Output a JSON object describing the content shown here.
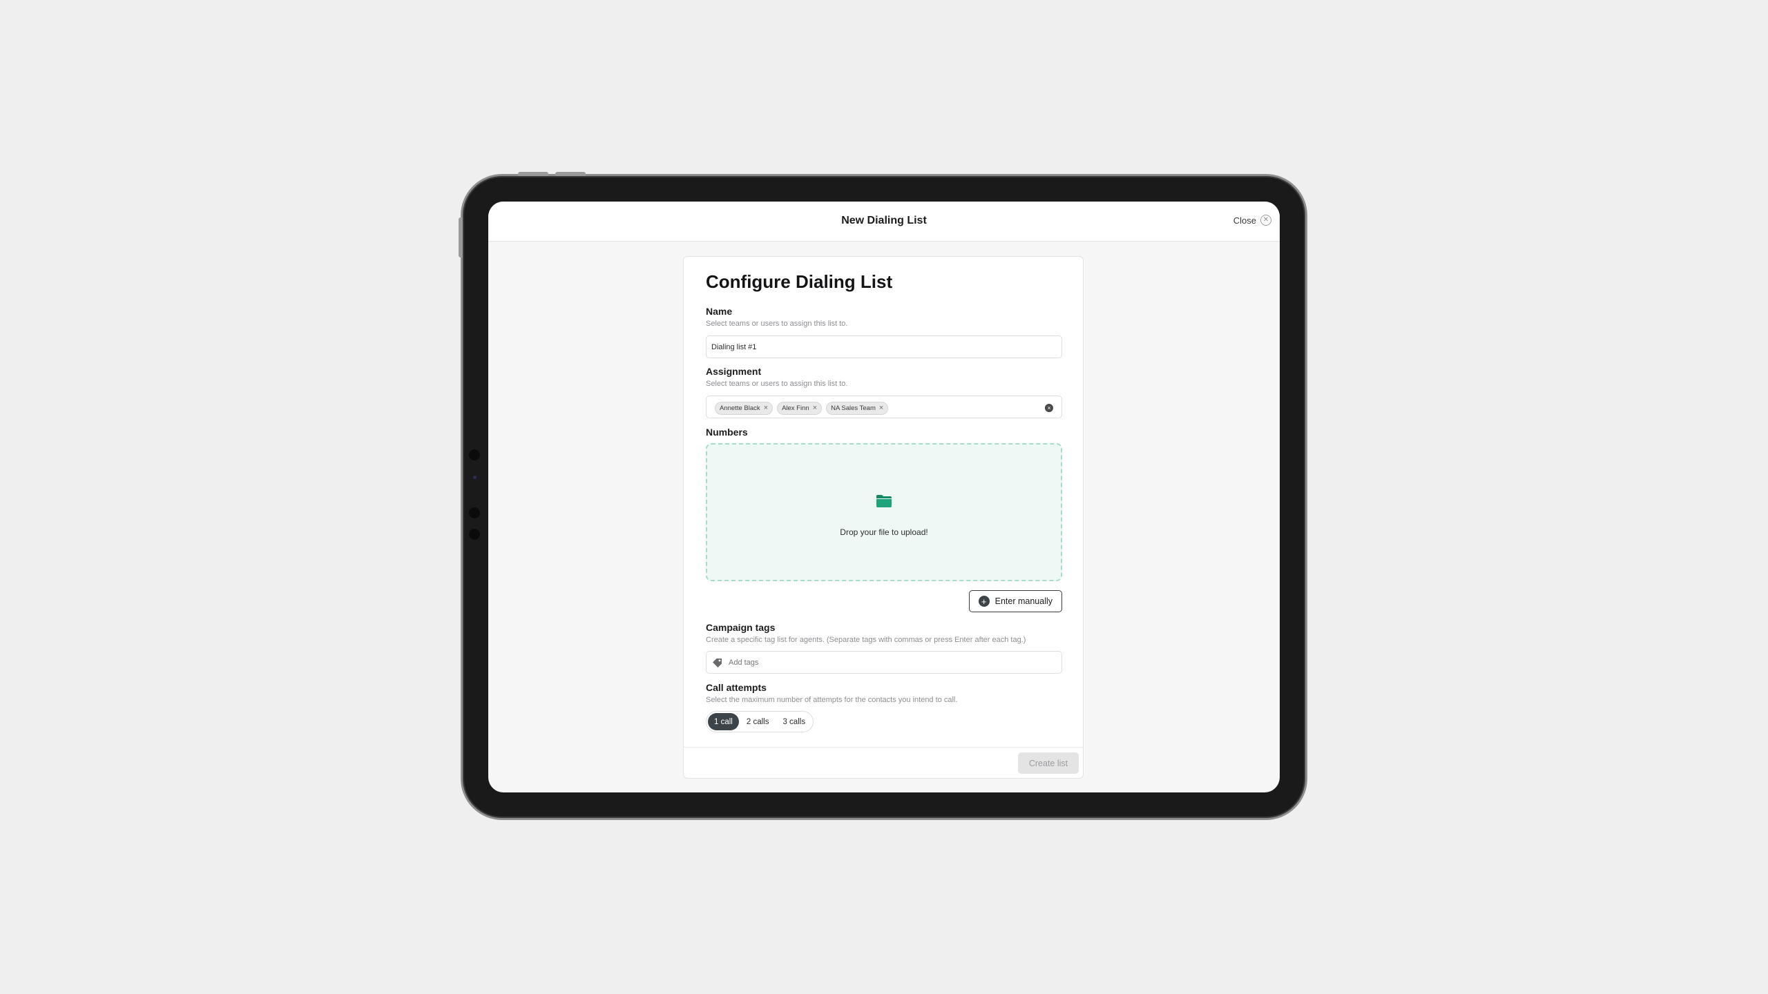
{
  "window": {
    "title": "New Dialing List",
    "close_label": "Close",
    "close_icon": "close-icon"
  },
  "form": {
    "heading": "Configure Dialing List",
    "name": {
      "label": "Name",
      "help": "Select teams or users to assign this list to.",
      "value": "Dialing list #1"
    },
    "assignment": {
      "label": "Assignment",
      "help": "Select teams or users to assign this list to.",
      "chips": [
        "Annette Black",
        "Alex Finn",
        "NA Sales Team"
      ]
    },
    "numbers": {
      "label": "Numbers",
      "drop_text": "Drop your file to upload!",
      "folder_icon": "folder-icon",
      "enter_manually": "Enter manually"
    },
    "campaign_tags": {
      "label": "Campaign tags",
      "help": "Create a specific tag list for agents. (Separate tags with commas or press Enter after each tag.)",
      "placeholder": "Add tags",
      "icon": "tag-icon"
    },
    "call_attempts": {
      "label": "Call attempts",
      "help": "Select the maximum number of attempts for the contacts you intend to call.",
      "options": [
        "1 call",
        "2 calls",
        "3 calls"
      ],
      "selected": "1 call"
    },
    "submit_label": "Create list"
  },
  "colors": {
    "accent_green": "#1fa37a",
    "dropzone_bg": "#eef8f4",
    "dark_button": "#3d4449"
  }
}
